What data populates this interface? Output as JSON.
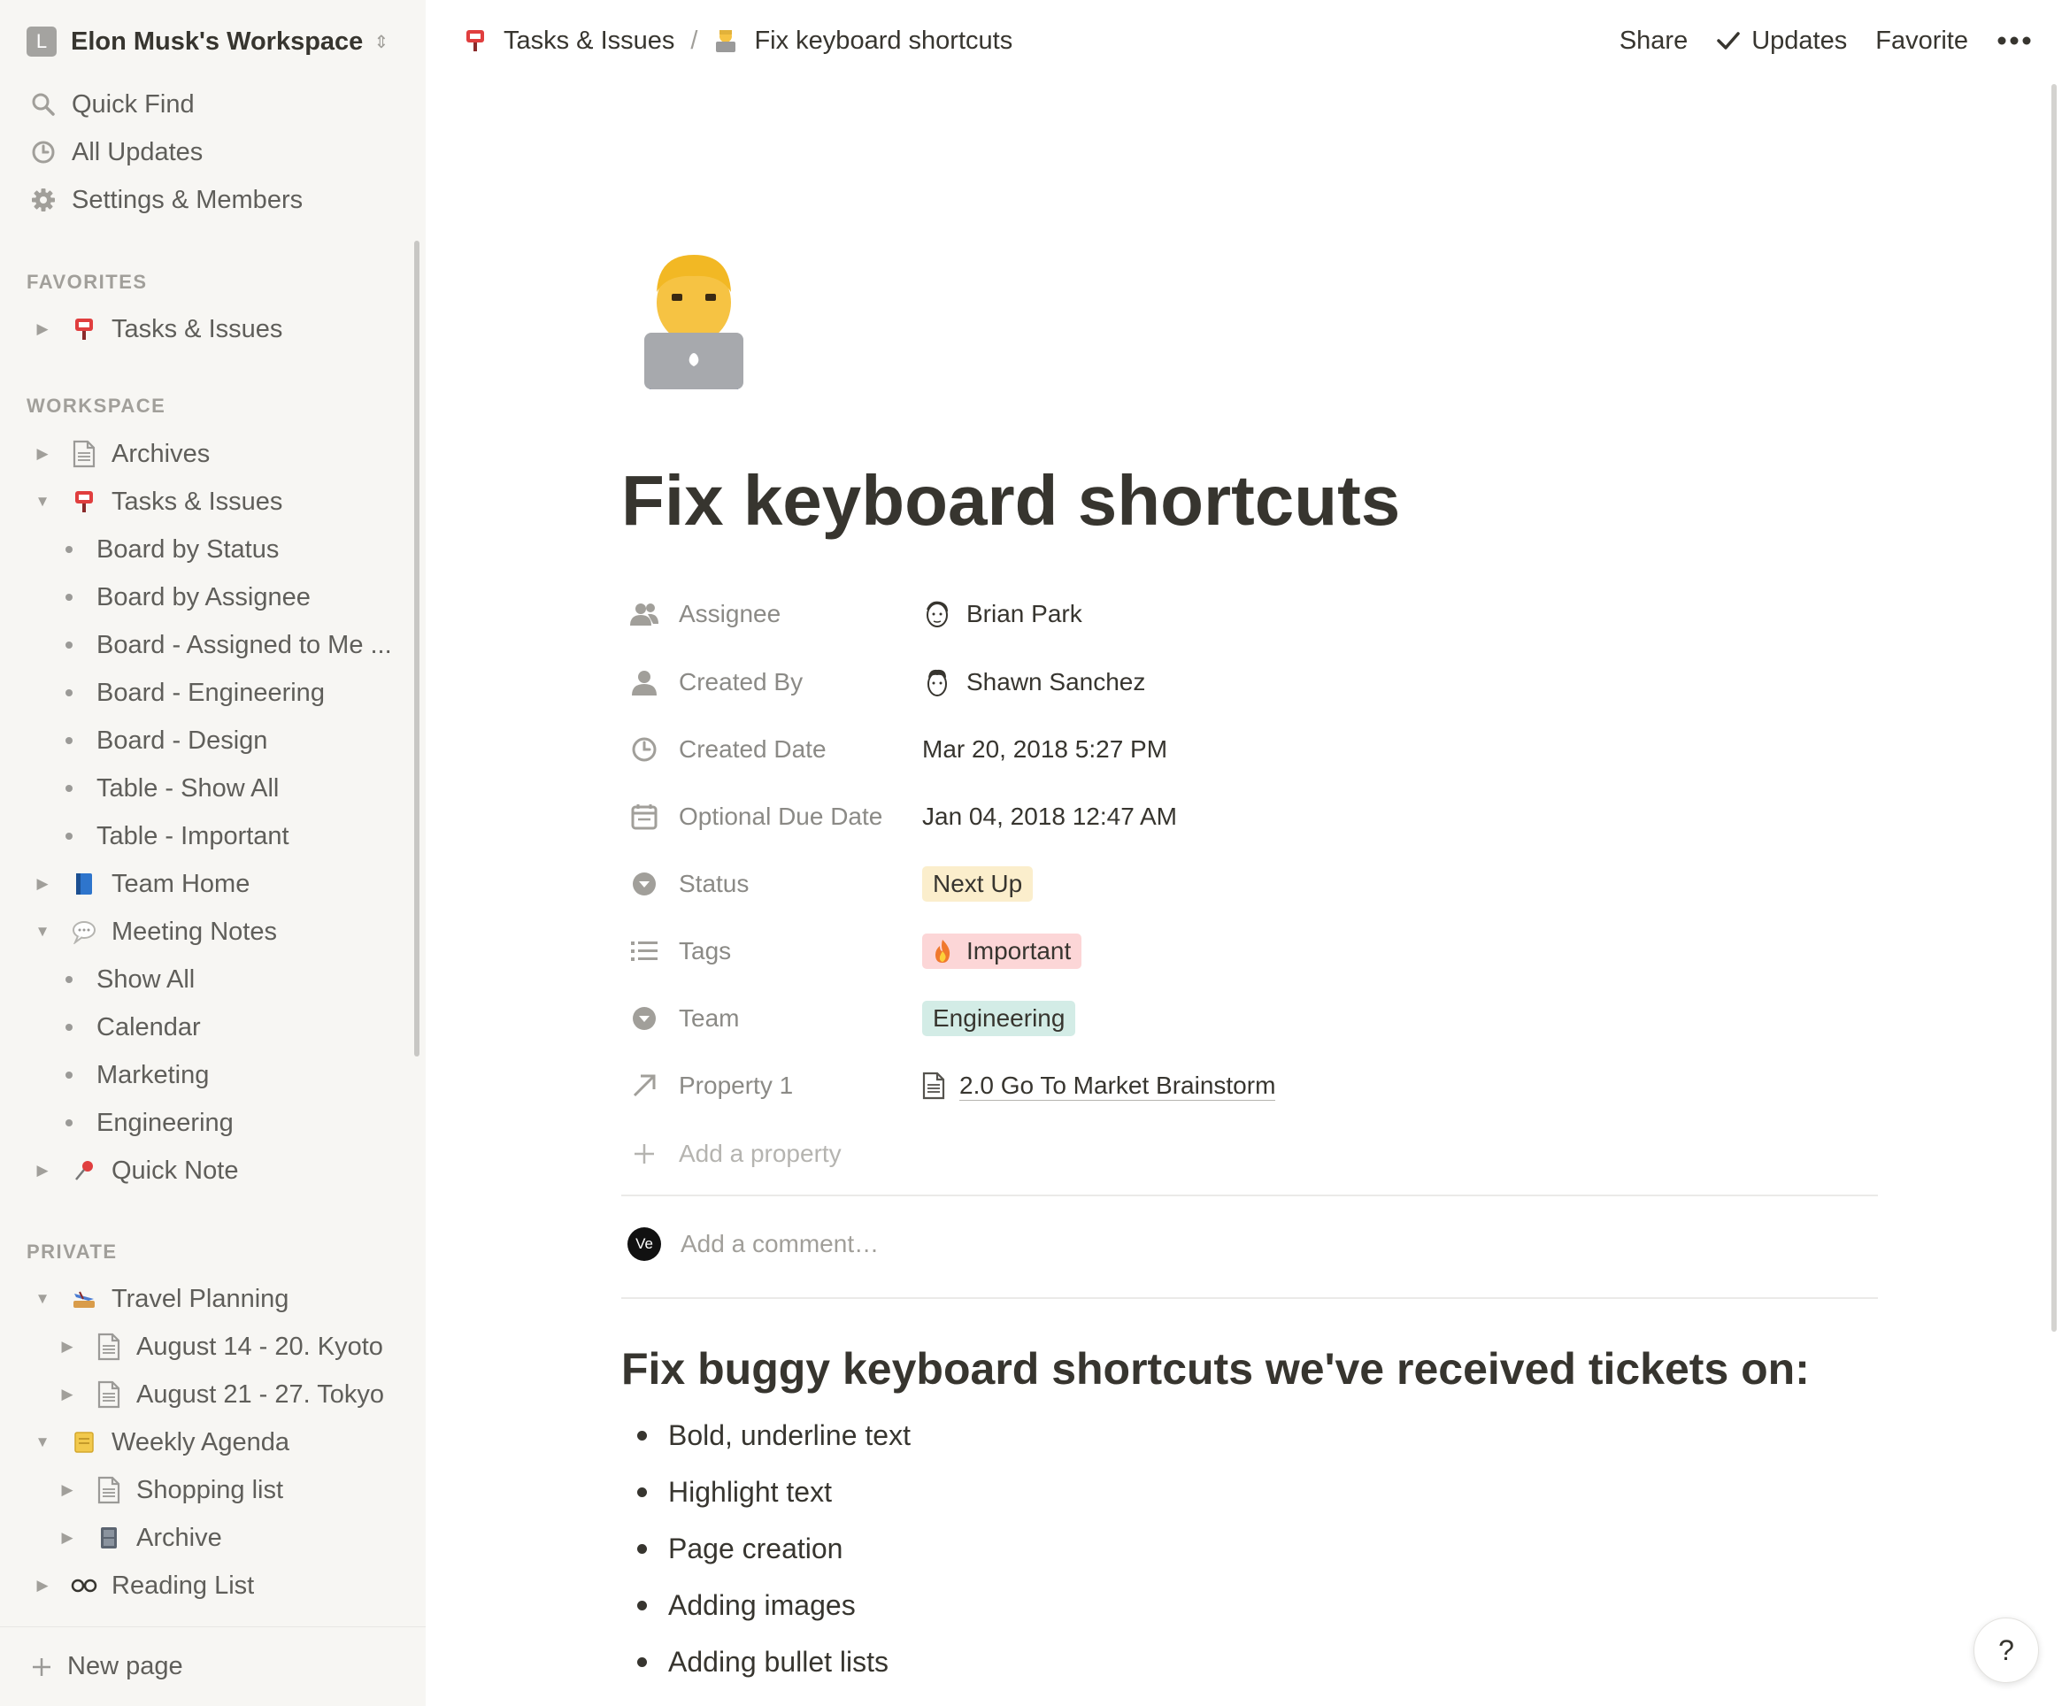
{
  "workspace": {
    "initial": "L",
    "name": "Elon Musk's Workspace"
  },
  "sidebar": {
    "quick_find": "Quick Find",
    "all_updates": "All Updates",
    "settings": "Settings & Members",
    "favorites_header": "FAVORITES",
    "favorites": [
      {
        "label": "Tasks & Issues",
        "icon": "red-mailbox-icon"
      }
    ],
    "workspace_header": "WORKSPACE",
    "workspace_items": [
      {
        "label": "Archives",
        "icon": "page-icon"
      },
      {
        "label": "Tasks & Issues",
        "icon": "red-mailbox-icon"
      },
      {
        "label": "Board by Status"
      },
      {
        "label": "Board by Assignee"
      },
      {
        "label": "Board - Assigned to Me ..."
      },
      {
        "label": "Board - Engineering"
      },
      {
        "label": "Board - Design"
      },
      {
        "label": "Table - Show All"
      },
      {
        "label": "Table - Important"
      },
      {
        "label": "Team Home",
        "icon": "blue-book-icon"
      },
      {
        "label": "Meeting Notes",
        "icon": "speech-bubble-icon"
      },
      {
        "label": "Show All"
      },
      {
        "label": "Calendar"
      },
      {
        "label": "Marketing"
      },
      {
        "label": "Engineering"
      },
      {
        "label": "Quick Note",
        "icon": "pushpin-icon"
      }
    ],
    "private_header": "PRIVATE",
    "private_items": [
      {
        "label": "Travel Planning",
        "icon": "plane-icon"
      },
      {
        "label": "August 14 - 20. Kyoto",
        "icon": "page-icon"
      },
      {
        "label": "August 21 - 27. Tokyo",
        "icon": "page-icon"
      },
      {
        "label": "Weekly Agenda",
        "icon": "note-icon"
      },
      {
        "label": "Shopping list",
        "icon": "page-icon"
      },
      {
        "label": "Archive",
        "icon": "cabinet-icon"
      },
      {
        "label": "Reading List",
        "icon": "glasses-icon"
      }
    ],
    "new_page": "New page"
  },
  "topbar": {
    "breadcrumb": [
      "Tasks & Issues",
      "Fix keyboard shortcuts"
    ],
    "share": "Share",
    "updates": "Updates",
    "favorite": "Favorite"
  },
  "page": {
    "title": "Fix keyboard shortcuts",
    "properties": [
      {
        "name": "Assignee",
        "value": "Brian Park"
      },
      {
        "name": "Created By",
        "value": "Shawn Sanchez"
      },
      {
        "name": "Created Date",
        "value": "Mar 20, 2018 5:27 PM"
      },
      {
        "name": "Optional Due Date",
        "value": "Jan 04, 2018 12:47 AM"
      },
      {
        "name": "Status",
        "value": "Next Up"
      },
      {
        "name": "Tags",
        "value": "Important"
      },
      {
        "name": "Team",
        "value": "Engineering"
      },
      {
        "name": "Property 1",
        "value": "2.0 Go To Market Brainstorm"
      }
    ],
    "add_property": "Add a property",
    "comment_placeholder": "Add a comment…",
    "comment_avatar": "Ve",
    "heading": "Fix buggy keyboard shortcuts we've received tickets on:",
    "bullets": [
      "Bold, underline text",
      "Highlight text",
      "Page creation",
      "Adding images",
      "Adding bullet lists"
    ]
  },
  "colors": {
    "status_bg": "#fbeecc",
    "tag_important_bg": "#fcd6d7",
    "team_bg": "#d3ece6"
  },
  "help": "?"
}
